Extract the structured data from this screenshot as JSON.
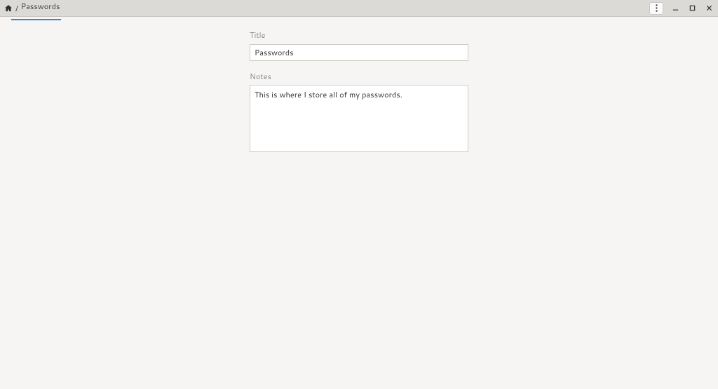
{
  "breadcrumb": {
    "separator": "/",
    "current": "Passwords"
  },
  "form": {
    "title_label": "Title",
    "title_value": "Passwords",
    "notes_label": "Notes",
    "notes_value": "This is where I store all of my passwords."
  }
}
